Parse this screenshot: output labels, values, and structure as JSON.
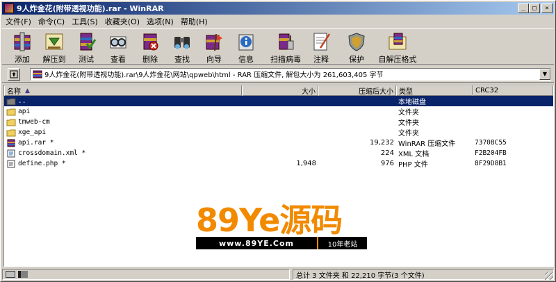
{
  "window": {
    "title": "9人炸金花(附带透视功能).rar - WinRAR",
    "min_glyph": "_",
    "max_glyph": "□",
    "close_glyph": "✕"
  },
  "menu": [
    "文件(F)",
    "命令(C)",
    "工具(S)",
    "收藏夹(O)",
    "选项(N)",
    "帮助(H)"
  ],
  "toolbar": {
    "add": "添加",
    "extract": "解压到",
    "test": "测试",
    "view": "查看",
    "delete": "删除",
    "find": "查找",
    "wizard": "向导",
    "info": "信息",
    "scan": "扫描病毒",
    "comment": "注释",
    "protect": "保护",
    "sfx": "自解压格式"
  },
  "address": {
    "path": "9人炸金花(附带透视功能).rar\\9人炸金花\\网站\\qpweb\\html - RAR 压缩文件, 解包大小为 261,603,405 字节"
  },
  "columns": {
    "name": "名称",
    "size": "大小",
    "packed": "压缩后大小",
    "type": "类型",
    "crc": "CRC32"
  },
  "files": [
    {
      "icon": "folder-up-icon",
      "name": "..",
      "size": "",
      "packed": "",
      "type": "本地磁盘",
      "crc": "",
      "selected": true
    },
    {
      "icon": "folder-icon",
      "name": "api",
      "size": "",
      "packed": "",
      "type": "文件夹",
      "crc": "",
      "selected": false
    },
    {
      "icon": "folder-icon",
      "name": "tmweb-cm",
      "size": "",
      "packed": "",
      "type": "文件夹",
      "crc": "",
      "selected": false
    },
    {
      "icon": "folder-icon",
      "name": "xge_api",
      "size": "",
      "packed": "",
      "type": "文件夹",
      "crc": "",
      "selected": false
    },
    {
      "icon": "rar-file-icon",
      "name": "api.rar *",
      "size": "",
      "packed": "19,232",
      "type": "WinRAR 压缩文件",
      "crc": "73708C55",
      "selected": false
    },
    {
      "icon": "xml-file-icon",
      "name": "crossdomain.xml *",
      "size": "",
      "packed": "224",
      "type": "XML 文档",
      "crc": "F2B204FB",
      "selected": false
    },
    {
      "icon": "php-file-icon",
      "name": "define.php *",
      "size": "1,948",
      "packed": "976",
      "type": "PHP 文件",
      "crc": "8F29D8B1",
      "selected": false
    }
  ],
  "watermark": {
    "main": "89Ye源码",
    "url": "www.89YE.Com",
    "tag": "10年老站"
  },
  "status": {
    "summary": "总计 3 文件夹 和 22,210 字节(3 个文件)"
  },
  "colors": {
    "selection": "#0a246a",
    "watermark": "#f28a00",
    "face": "#d4d0c8"
  }
}
